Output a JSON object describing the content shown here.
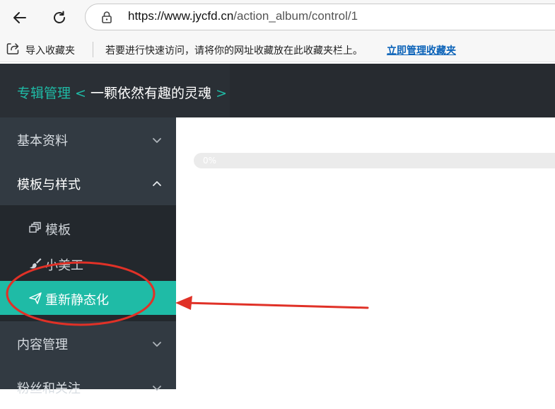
{
  "browser": {
    "url_domain": "https://www.jycfd.cn",
    "url_path": "/action_album/control/1",
    "import_favorites": "导入收藏夹",
    "favorites_hint": "若要进行快速访问，请将你的网址收藏放在此收藏夹栏上。",
    "manage_favorites": "立即管理收藏夹"
  },
  "header": {
    "section": "专辑管理",
    "open_bracket": " < ",
    "album_name": "一颗依然有趣的灵魂",
    "close_bracket": " >"
  },
  "sidebar": {
    "items": [
      {
        "label": "基本资料",
        "expanded": false
      },
      {
        "label": "模板与样式",
        "expanded": true
      },
      {
        "label": "内容管理",
        "expanded": false
      },
      {
        "label": "粉丝和关注",
        "expanded": false
      }
    ],
    "subitems": [
      {
        "label": "模板",
        "icon": "template-icon"
      },
      {
        "label": "小美工",
        "icon": "brush-icon"
      },
      {
        "label": "重新静态化",
        "icon": "paper-plane-icon",
        "active": true
      }
    ]
  },
  "progress": {
    "value": 0,
    "label": "0%"
  },
  "colors": {
    "accent": "#1fbba6",
    "header_bg": "#2a2f35",
    "sidebar_bg": "#323a42",
    "submenu_bg": "#23282d",
    "annotation_red": "#e03127"
  }
}
